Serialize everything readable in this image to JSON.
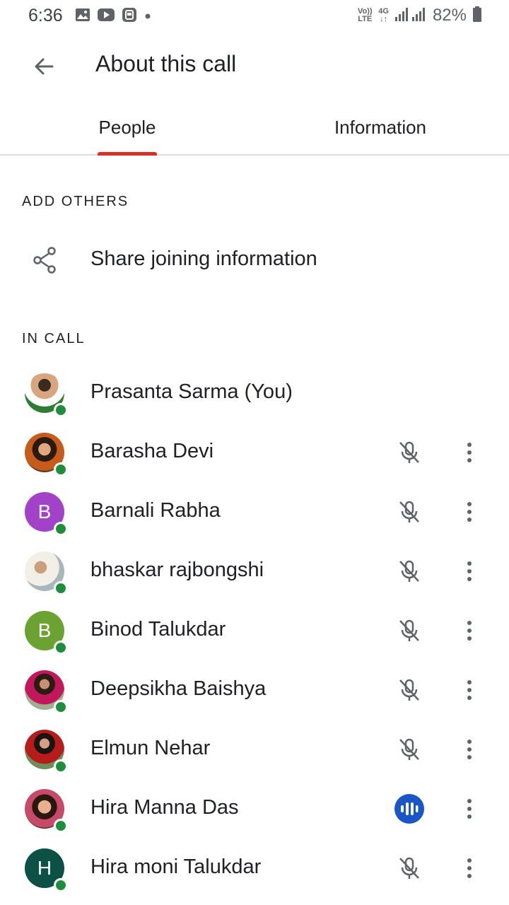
{
  "status_bar": {
    "time": "6:36",
    "volte_label": "Vo)) LTE",
    "network_label": "4G",
    "battery_percent": "82%",
    "icons": [
      "image-icon",
      "youtube-icon",
      "app-notification-icon",
      "dot-icon",
      "signal-icon",
      "battery-icon"
    ]
  },
  "app_bar": {
    "title": "About this call",
    "back_icon": "arrow-back-icon"
  },
  "tabs": [
    {
      "label": "People",
      "selected": true
    },
    {
      "label": "Information",
      "selected": false
    }
  ],
  "colors": {
    "tab_indicator": "#d93025",
    "presence": "#1e8e3e",
    "speaking": "#1a56c8",
    "avatar_purple": "#a142c9",
    "avatar_green": "#6aa331",
    "avatar_dark_green": "#0b5145"
  },
  "add_others": {
    "header": "ADD OTHERS",
    "share_label": "Share joining information",
    "share_icon": "share-icon"
  },
  "in_call": {
    "header": "IN CALL",
    "participants": [
      {
        "name": "Prasanta Sarma (You)",
        "avatar_type": "photo",
        "avatar_letter": "",
        "mic": "none"
      },
      {
        "name": "Barasha Devi",
        "avatar_type": "photo",
        "avatar_letter": "",
        "mic": "muted"
      },
      {
        "name": "Barnali Rabha",
        "avatar_type": "letter",
        "avatar_letter": "B",
        "mic": "muted"
      },
      {
        "name": "bhaskar rajbongshi",
        "avatar_type": "photo",
        "avatar_letter": "",
        "mic": "muted"
      },
      {
        "name": "Binod Talukdar",
        "avatar_type": "letter",
        "avatar_letter": "B",
        "mic": "muted"
      },
      {
        "name": "Deepsikha Baishya",
        "avatar_type": "photo",
        "avatar_letter": "",
        "mic": "muted"
      },
      {
        "name": "Elmun Nehar",
        "avatar_type": "photo",
        "avatar_letter": "",
        "mic": "muted"
      },
      {
        "name": "Hira Manna Das",
        "avatar_type": "photo",
        "avatar_letter": "",
        "mic": "speaking"
      },
      {
        "name": "Hira moni Talukdar",
        "avatar_type": "letter",
        "avatar_letter": "H",
        "mic": "muted"
      }
    ]
  }
}
